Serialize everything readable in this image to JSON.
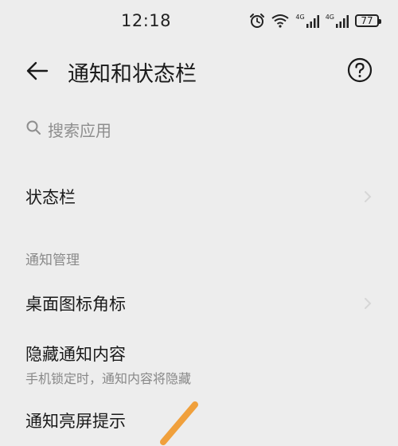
{
  "status_bar": {
    "time": "12:18",
    "signal_1_label": "4G",
    "signal_2_label": "4G",
    "battery": "77"
  },
  "header": {
    "title": "通知和状态栏"
  },
  "search": {
    "placeholder": "搜索应用"
  },
  "rows": {
    "status_bar_row": "状态栏",
    "section_notification_management": "通知管理",
    "desktop_badge": "桌面图标角标",
    "hide_content": "隐藏通知内容",
    "hide_content_sub": "手机锁定时，通知内容将隐藏",
    "wake_screen": "通知亮屏提示"
  },
  "colors": {
    "background": "#ededed",
    "annotation_stroke": "#f0a03c"
  }
}
